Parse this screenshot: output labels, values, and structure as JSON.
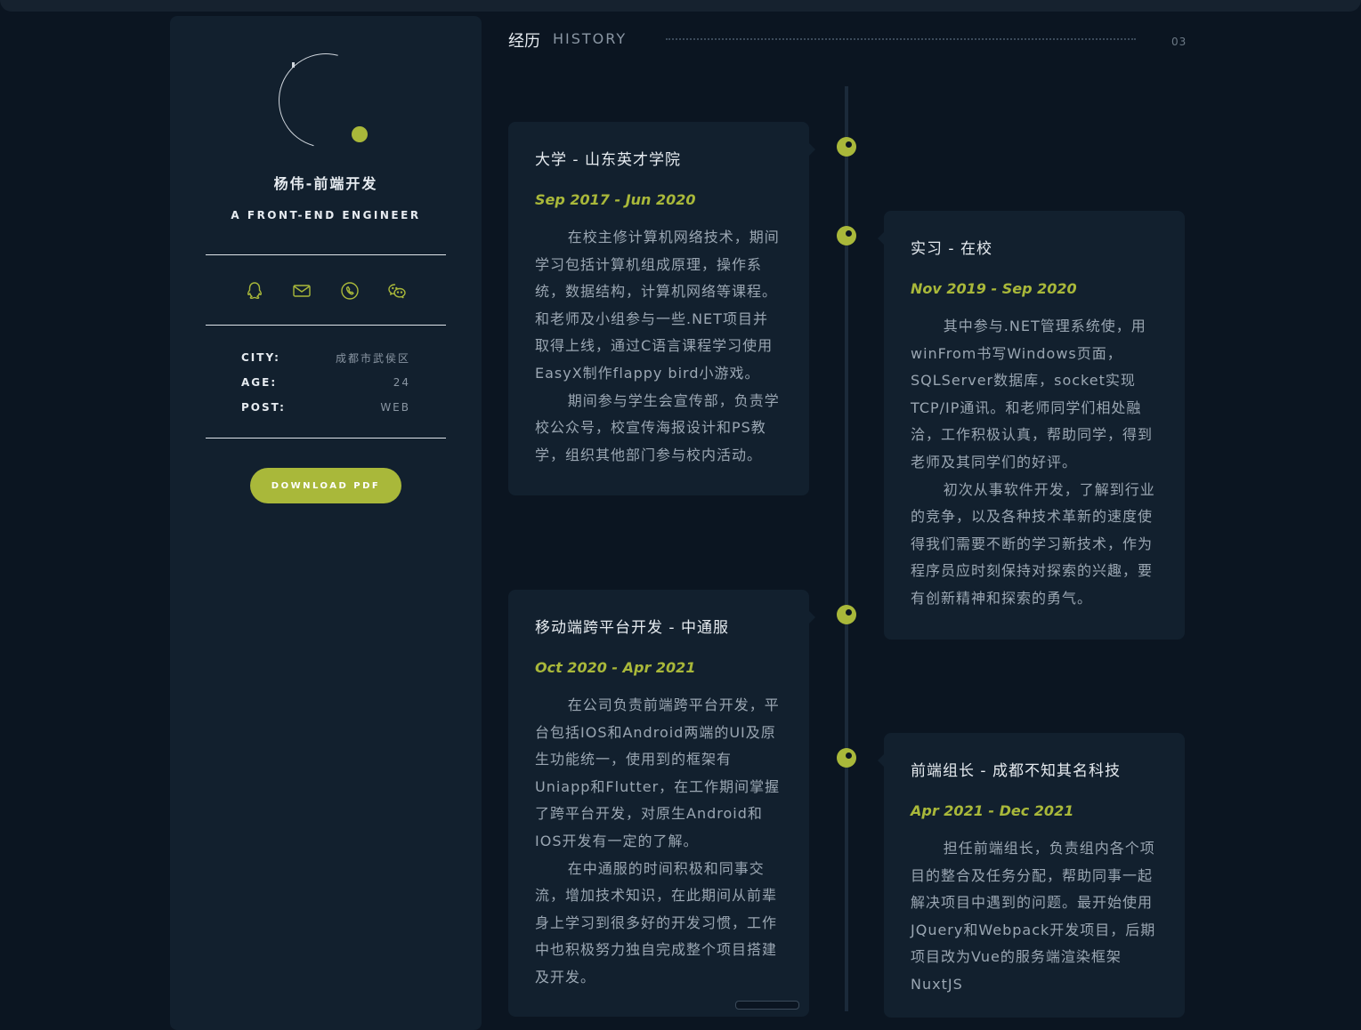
{
  "profile": {
    "name": "杨伟-前端开发",
    "role": "A FRONT-END ENGINEER",
    "social_icons": [
      "qq-icon",
      "mail-icon",
      "phone-icon",
      "wechat-icon"
    ],
    "info": [
      {
        "key": "CITY:",
        "value": "成都市武侯区"
      },
      {
        "key": "AGE:",
        "value": "24"
      },
      {
        "key": "POST:",
        "value": "WEB"
      }
    ],
    "download_label": "DOWNLOAD PDF"
  },
  "section": {
    "title_cn": "经历",
    "title_en": "HISTORY",
    "number": "03"
  },
  "timeline": [
    {
      "side": "left",
      "title": "大学 - 山东英才学院",
      "date": "Sep 2017 - Jun 2020",
      "paragraphs": [
        "在校主修计算机网络技术，期间学习包括计算机组成原理，操作系统，数据结构，计算机网络等课程。和老师及小组参与一些.NET项目并取得上线，通过C语言课程学习使用EasyX制作flappy bird小游戏。",
        "期间参与学生会宣传部，负责学校公众号，校宣传海报设计和PS教学，组织其他部门参与校内活动。"
      ]
    },
    {
      "side": "right",
      "title": "实习 - 在校",
      "date": "Nov 2019 - Sep 2020",
      "paragraphs": [
        "其中参与.NET管理系统使，用winFrom书写Windows页面，SQLServer数据库，socket实现TCP/IP通讯。和老师同学们相处融洽，工作积极认真，帮助同学，得到老师及其同学们的好评。",
        "初次从事软件开发，了解到行业的竞争，以及各种技术革新的速度使得我们需要不断的学习新技术，作为程序员应时刻保持对探索的兴趣，要有创新精神和探索的勇气。"
      ]
    },
    {
      "side": "left",
      "title": "移动端跨平台开发 - 中通服",
      "date": "Oct 2020 - Apr 2021",
      "paragraphs": [
        "在公司负责前端跨平台开发，平台包括IOS和Android两端的UI及原生功能统一，使用到的框架有Uniapp和Flutter，在工作期间掌握了跨平台开发，对原生Android和IOS开发有一定的了解。",
        "在中通服的时间积极和同事交流，增加技术知识，在此期间从前辈身上学习到很多好的开发习惯，工作中也积极努力独自完成整个项目搭建及开发。"
      ]
    },
    {
      "side": "right",
      "title": "前端组长 - 成都不知其名科技",
      "date": "Apr 2021 - Dec 2021",
      "paragraphs": [
        "担任前端组长，负责组内各个项目的整合及任务分配，帮助同事一起解决项目中遇到的问题。最开始使用JQuery和Webpack开发项目，后期项目改为Vue的服务端渲染框架NuxtJS"
      ]
    }
  ],
  "colors": {
    "accent": "#a9b83a",
    "background": "#0b1521",
    "panel": "#12202e"
  }
}
